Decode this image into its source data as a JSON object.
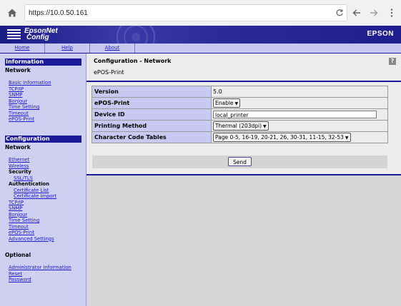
{
  "browser": {
    "url": "https://10.0.50.161",
    "icons": [
      "home-icon",
      "reload-icon",
      "back-icon",
      "forward-icon",
      "menu-icon"
    ]
  },
  "header": {
    "logo_line1": "EpsonNet",
    "logo_line2": "Config",
    "brand": "EPSON"
  },
  "topnav": {
    "items": [
      {
        "label": "Home"
      },
      {
        "label": "Help"
      },
      {
        "label": "About"
      }
    ]
  },
  "sidebar": {
    "information": {
      "heading": "Information",
      "sub": "Network",
      "links": [
        "Basic Information",
        "TCP/IP",
        "SNMP",
        "Bonjour",
        "Time Setting",
        "Timeout",
        "ePOS-Print"
      ]
    },
    "configuration": {
      "heading": "Configuration",
      "sub": "Network",
      "ethernet": "Ethernet",
      "wireless": "Wireless",
      "security": "Security",
      "ssl": "SSL/TLS",
      "authentication": "Authentication",
      "cert_list": "Certificate List",
      "cert_import": "Certificate Import",
      "links": [
        "TCP/IP",
        "SNMP",
        "Bonjour",
        "Time Setting",
        "Timeout",
        "ePOS-Print",
        "Advanced Settings"
      ]
    },
    "optional": {
      "heading": "Optional",
      "links": [
        "Administrator Information",
        "Reset",
        "Password"
      ]
    }
  },
  "main": {
    "title": "Configuration - Network",
    "subtitle": "ePOS-Print",
    "help": "?",
    "rows": {
      "version": {
        "label": "Version",
        "value": "5.0"
      },
      "epos": {
        "label": "ePOS-Print",
        "value": "Enable"
      },
      "device": {
        "label": "Device ID",
        "value": "local_printer"
      },
      "method": {
        "label": "Printing Method",
        "value": "Thermal (203dpi)"
      },
      "codes": {
        "label": "Character Code Tables",
        "value": "Page 0-5, 16-19, 20-21, 26, 30-31, 11-15, 32-53"
      }
    },
    "send_label": "Send"
  }
}
